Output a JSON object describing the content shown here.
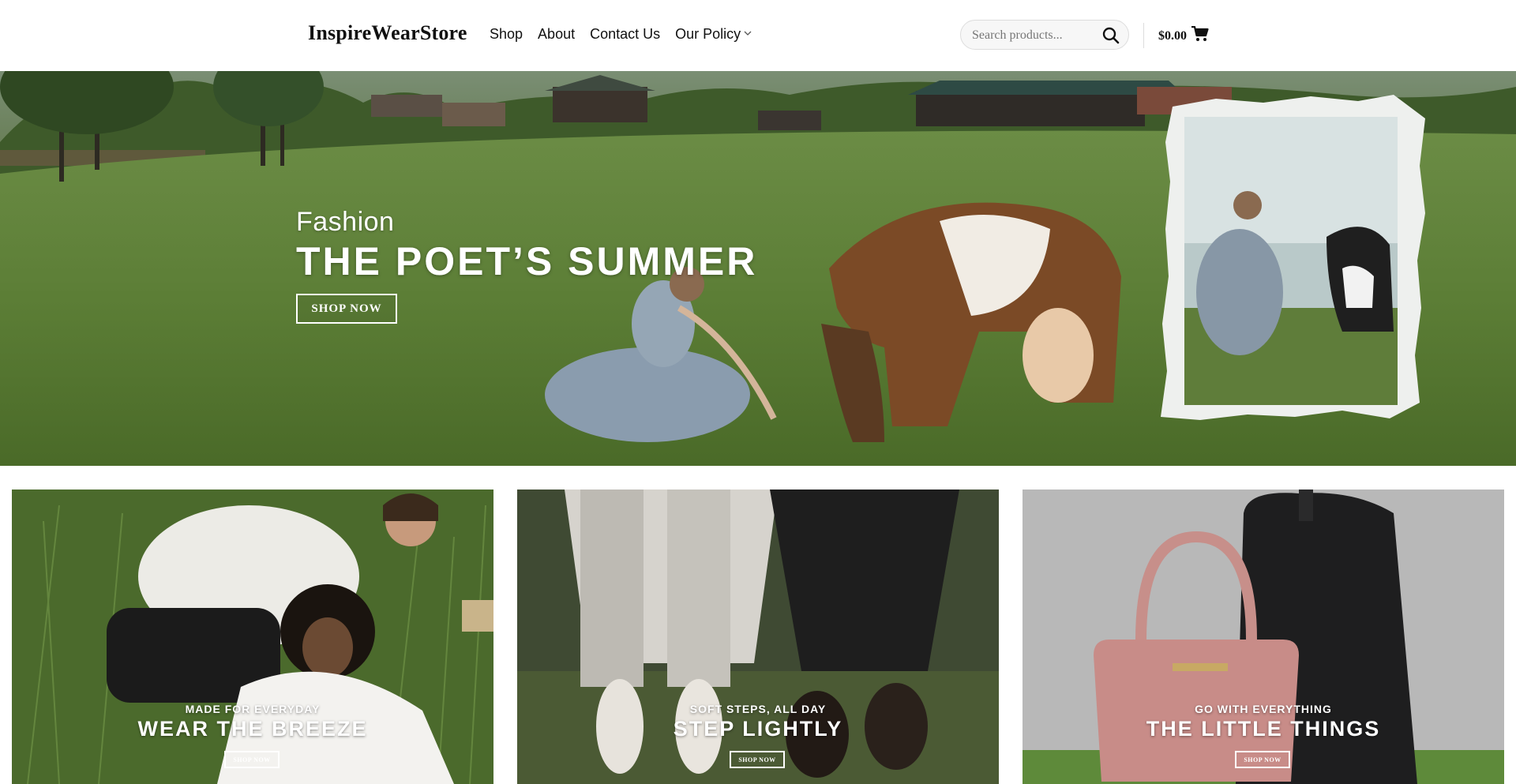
{
  "header": {
    "logo": "InspireWearStore",
    "nav": [
      {
        "label": "Shop"
      },
      {
        "label": "About"
      },
      {
        "label": "Contact Us"
      },
      {
        "label": "Our Policy"
      }
    ],
    "search": {
      "placeholder": "Search products...",
      "value": ""
    },
    "cart": {
      "total": "$0.00"
    }
  },
  "hero": {
    "eyebrow": "Fashion",
    "title": "THE POET’S SUMMER",
    "cta": "SHOP NOW"
  },
  "promos": [
    {
      "eyebrow": "MADE FOR EVERYDAY",
      "title": "WEAR THE BREEZE",
      "cta": "SHOP NOW"
    },
    {
      "eyebrow": "SOFT STEPS, ALL DAY",
      "title": "STEP LIGHTLY",
      "cta": "SHOP NOW"
    },
    {
      "eyebrow": "GO WITH EVERYTHING",
      "title": "THE LITTLE THINGS",
      "cta": "SHOP NOW"
    }
  ],
  "colors": {
    "header_bg": "#ffffff",
    "text": "#111111",
    "grass": "#5e7f3c",
    "overlay_text": "#ffffff"
  },
  "icons": {
    "search": "search-icon",
    "cart": "cart-icon",
    "dropdown": "chevron-down-icon"
  }
}
